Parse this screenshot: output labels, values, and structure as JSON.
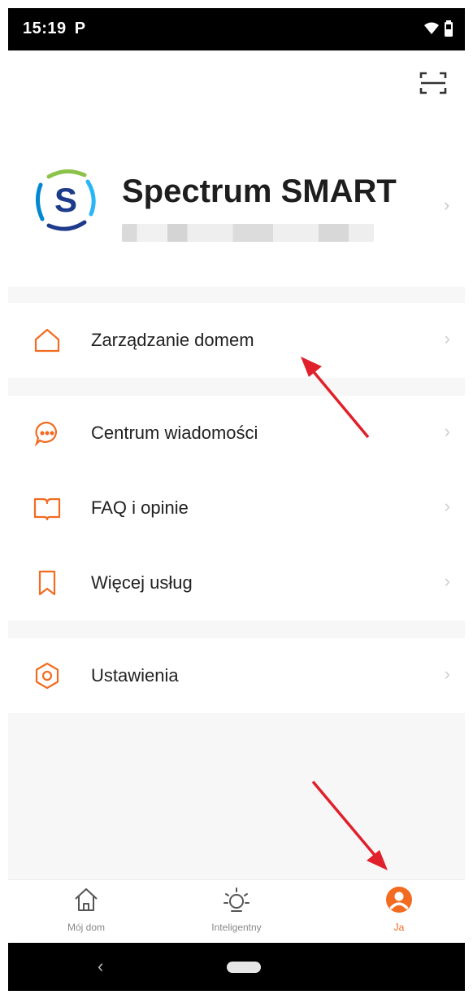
{
  "status_bar": {
    "time": "15:19",
    "notification_glyph": "P"
  },
  "profile": {
    "name": "Spectrum SMART"
  },
  "menu": {
    "home_management": "Zarządzanie domem",
    "message_center": "Centrum wiadomości",
    "faq": "FAQ i opinie",
    "more_services": "Więcej usług",
    "settings": "Ustawienia"
  },
  "tabs": [
    {
      "label": "Mój dom"
    },
    {
      "label": "Inteligentny"
    },
    {
      "label": "Ja"
    }
  ],
  "colors": {
    "accent": "#f26b21",
    "arrow": "#e0202a"
  }
}
